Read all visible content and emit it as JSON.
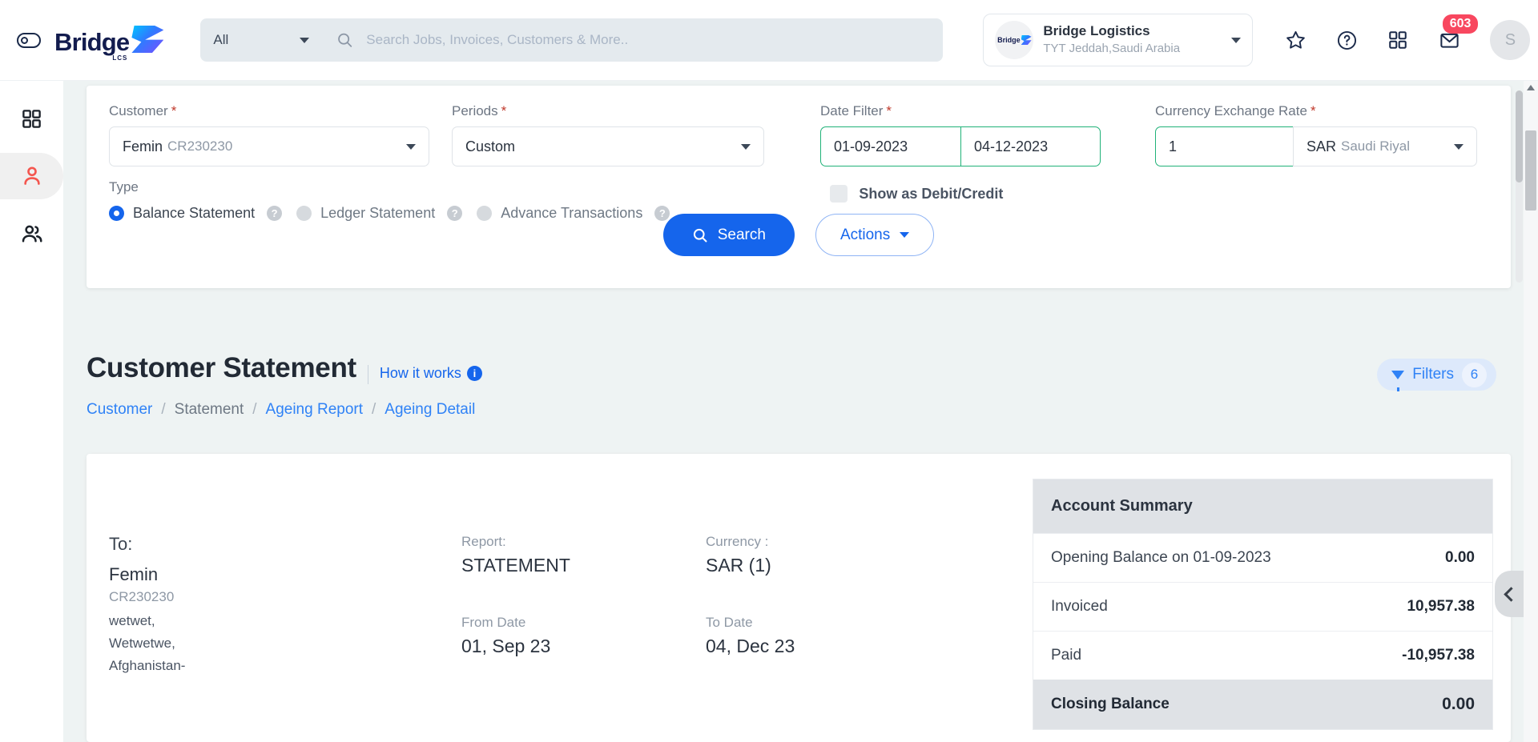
{
  "topbar": {
    "eye_toggle": "sidebar-toggle",
    "brand": {
      "name": "Bridge",
      "sub": "LCS"
    },
    "scope": {
      "value": "All"
    },
    "search": {
      "placeholder": "Search Jobs, Invoices, Customers & More..",
      "value": ""
    },
    "org": {
      "name": "Bridge Logistics",
      "location": "TYT Jeddah,Saudi Arabia",
      "avatar_text": "Bridge"
    },
    "icons": {
      "star": "star-icon",
      "help": "?",
      "apps": "grid-icon",
      "mail": "mail-icon"
    },
    "notifications": "603",
    "user_initial": "S"
  },
  "rail": {
    "items": [
      {
        "name": "dashboard",
        "icon": "grid-icon",
        "active": false
      },
      {
        "name": "customer",
        "icon": "person-icon",
        "active": true
      },
      {
        "name": "contacts",
        "icon": "people-icon",
        "active": false
      }
    ]
  },
  "filters": {
    "customer": {
      "label": "Customer",
      "required": "*",
      "value": "Femin",
      "code": "CR230230"
    },
    "periods": {
      "label": "Periods",
      "required": "*",
      "value": "Custom"
    },
    "date_filter": {
      "label": "Date Filter",
      "required": "*",
      "from": "01-09-2023",
      "to": "04-12-2023"
    },
    "exchange_rate": {
      "label": "Currency Exchange Rate",
      "required": "*",
      "rate": "1",
      "currency_code": "SAR",
      "currency_name": "Saudi Riyal"
    },
    "type": {
      "label": "Type",
      "options": [
        {
          "label": "Balance Statement",
          "selected": true
        },
        {
          "label": "Ledger Statement",
          "selected": false
        },
        {
          "label": "Advance Transactions",
          "selected": false
        }
      ]
    },
    "debit_credit": {
      "label": "Show as Debit/Credit",
      "checked": false
    },
    "search_button": "Search",
    "actions_button": "Actions"
  },
  "page": {
    "title": "Customer Statement",
    "how_it_works": "How it works",
    "info_glyph": "i",
    "breadcrumbs": [
      {
        "label": "Customer",
        "current": false
      },
      {
        "label": "Statement",
        "current": true
      },
      {
        "label": "Ageing Report",
        "current": false
      },
      {
        "label": "Ageing Detail",
        "current": false
      }
    ],
    "breadcrumb_separator": "/",
    "filters_pill": {
      "label": "Filters",
      "count": "6"
    }
  },
  "statement": {
    "to_label": "To:",
    "to_name": "Femin",
    "to_code": "CR230230",
    "address_lines": [
      "wetwet,",
      "Wetwetwe,",
      "Afghanistan-"
    ],
    "report_label": "Report:",
    "report_value": "STATEMENT",
    "currency_label": "Currency :",
    "currency_value": "SAR (1)",
    "from_date_label": "From Date",
    "from_date_value": "01, Sep 23",
    "to_date_label": "To Date",
    "to_date_value": "04, Dec 23"
  },
  "account_summary": {
    "heading": "Account Summary",
    "rows": [
      {
        "label": "Opening Balance on 01-09-2023",
        "value": "0.00"
      },
      {
        "label": "Invoiced",
        "value": "10,957.38"
      },
      {
        "label": "Paid",
        "value": "-10,957.38"
      }
    ],
    "total": {
      "label": "Closing Balance",
      "value": "0.00"
    }
  },
  "colors": {
    "accent_blue": "#1565ec",
    "link_blue": "#2f82f6",
    "valid_green": "#20b278",
    "badge_red": "#f8475f",
    "active_rail_red": "#f4564f",
    "page_bg": "#eef3f3"
  }
}
